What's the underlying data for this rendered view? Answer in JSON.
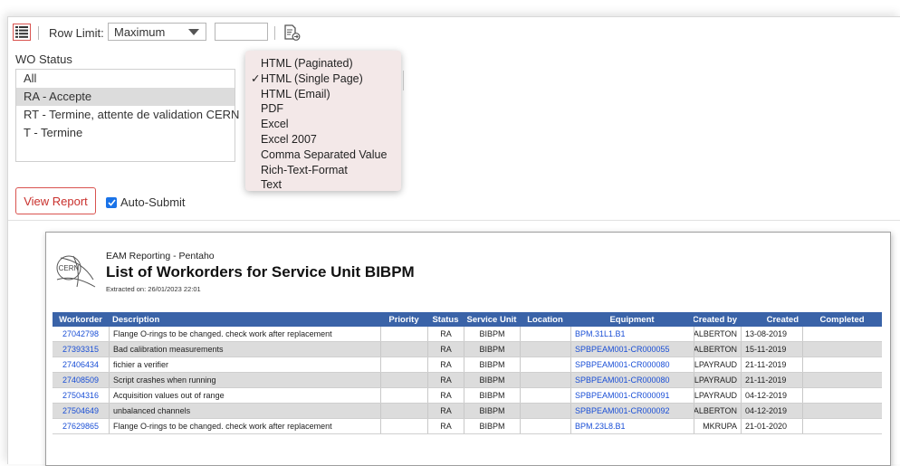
{
  "toolbar": {
    "row_limit_label": "Row Limit:",
    "row_limit_value": "Maximum",
    "row_limit_extra": ""
  },
  "filters": {
    "wo_status_label": "WO Status",
    "options": [
      "All",
      "RA - Accepte",
      "RT - Termine, attente de validation CERN",
      "T - Termine"
    ],
    "selected_index": 1
  },
  "export_menu": {
    "items": [
      {
        "label": "HTML (Paginated)",
        "checked": false
      },
      {
        "label": "HTML (Single Page)",
        "checked": true
      },
      {
        "label": "HTML (Email)",
        "checked": false
      },
      {
        "label": "PDF",
        "checked": false
      },
      {
        "label": "Excel",
        "checked": false
      },
      {
        "label": "Excel 2007",
        "checked": false
      },
      {
        "label": "Comma Separated Value",
        "checked": false
      },
      {
        "label": "Rich-Text-Format",
        "checked": false
      },
      {
        "label": "Text",
        "checked": false
      }
    ],
    "check_mark": "✓"
  },
  "actions": {
    "view_report": "View Report",
    "auto_submit": "Auto-Submit",
    "auto_submit_checked": true
  },
  "report": {
    "logo_text": "CERN",
    "app_name": "EAM Reporting - Pentaho",
    "title": "List of Workorders for Service Unit BIBPM",
    "extracted": "Extracted on: 26/01/2023 22:01",
    "columns": [
      "Workorder",
      "Description",
      "Priority",
      "Status",
      "Service Unit",
      "Location",
      "Equipment",
      "Created by",
      "Created",
      "Completed"
    ],
    "rows": [
      [
        "27042798",
        "Flange O-rings to be changed. check work after replacement",
        "",
        "RA",
        "BIBPM",
        "",
        "BPM.31L1.B1",
        "ALBERTON",
        "13-08-2019",
        ""
      ],
      [
        "27393315",
        "Bad calibration measurements",
        "",
        "RA",
        "BIBPM",
        "",
        "SPBPEAM001-CR000055",
        "ALBERTON",
        "15-11-2019",
        ""
      ],
      [
        "27406434",
        "fichier a verifier",
        "",
        "RA",
        "BIBPM",
        "",
        "SPBPEAM001-CR000080",
        "LPAYRAUD",
        "21-11-2019",
        ""
      ],
      [
        "27408509",
        "Script crashes when running",
        "",
        "RA",
        "BIBPM",
        "",
        "SPBPEAM001-CR000080",
        "LPAYRAUD",
        "21-11-2019",
        ""
      ],
      [
        "27504316",
        "Acquisition values out of range",
        "",
        "RA",
        "BIBPM",
        "",
        "SPBPEAM001-CR000091",
        "LPAYRAUD",
        "04-12-2019",
        ""
      ],
      [
        "27504649",
        "unbalanced channels",
        "",
        "RA",
        "BIBPM",
        "",
        "SPBPEAM001-CR000092",
        "ALBERTON",
        "04-12-2019",
        ""
      ],
      [
        "27629865",
        "Flange O-rings to be changed. check work after replacement",
        "",
        "RA",
        "BIBPM",
        "",
        "BPM.23L8.B1",
        "MKRUPA",
        "21-01-2020",
        ""
      ]
    ]
  },
  "colors": {
    "accent_red": "#d9534f",
    "table_header": "#3a63a8",
    "link_blue": "#1a4fd6",
    "menu_bg": "#f3e8e8",
    "checkbox_blue": "#1a73e8"
  },
  "icons": {
    "menu": "list-menu-icon",
    "export": "export-document-icon",
    "dropdown": "chevron-down-icon",
    "logo": "cern-logo"
  }
}
